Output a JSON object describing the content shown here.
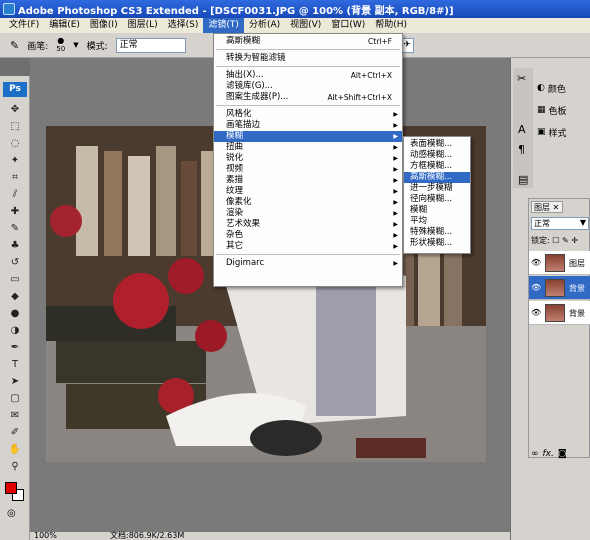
{
  "titlebar": {
    "title": "Adobe Photoshop CS3 Extended - [DSCF0031.JPG @ 100% (背景 副本, RGB/8#)]"
  },
  "menubar": {
    "items": [
      "文件(F)",
      "编辑(E)",
      "图像(I)",
      "图层(L)",
      "选择(S)",
      "滤镜(T)",
      "分析(A)",
      "视图(V)",
      "窗口(W)",
      "帮助(H)"
    ],
    "active_index": 5
  },
  "options": {
    "brush_label": "画笔:",
    "brush_size": "50",
    "mode_label": "模式:",
    "mode_value": "正常"
  },
  "toolbox": {
    "logo": "Ps"
  },
  "filter_menu": {
    "top": [
      {
        "label": "高斯模糊",
        "shortcut": "Ctrl+F"
      }
    ],
    "smart": [
      {
        "label": "转换为智能滤镜"
      }
    ],
    "special": [
      {
        "label": "抽出(X)...",
        "shortcut": "Alt+Ctrl+X"
      },
      {
        "label": "滤镜库(G)..."
      },
      {
        "label": "图案生成器(P)...",
        "shortcut": "Alt+Shift+Ctrl+X"
      }
    ],
    "groups": [
      "风格化",
      "画笔描边",
      "模糊",
      "扭曲",
      "锐化",
      "视频",
      "素描",
      "纹理",
      "像素化",
      "渲染",
      "艺术效果",
      "杂色",
      "其它"
    ],
    "highlight_group": 2,
    "digimarc": "Digimarc"
  },
  "blur_submenu": {
    "items": [
      "表面模糊...",
      "动感模糊...",
      "方框模糊...",
      "高斯模糊...",
      "进一步模糊",
      "径向模糊...",
      "模糊",
      "平均",
      "特殊模糊...",
      "形状模糊..."
    ],
    "highlight_index": 3
  },
  "status": {
    "zoom": "100%",
    "doc": "文档:806.9K/2.63M"
  },
  "panels": {
    "color": "颜色",
    "swatches": "色板",
    "styles": "样式",
    "layers_tab": "图层",
    "blend": "正常",
    "lock": "锁定:",
    "layers": [
      {
        "name": "图层"
      },
      {
        "name": "背景"
      },
      {
        "name": "背景"
      }
    ],
    "selected_layer": 1
  }
}
